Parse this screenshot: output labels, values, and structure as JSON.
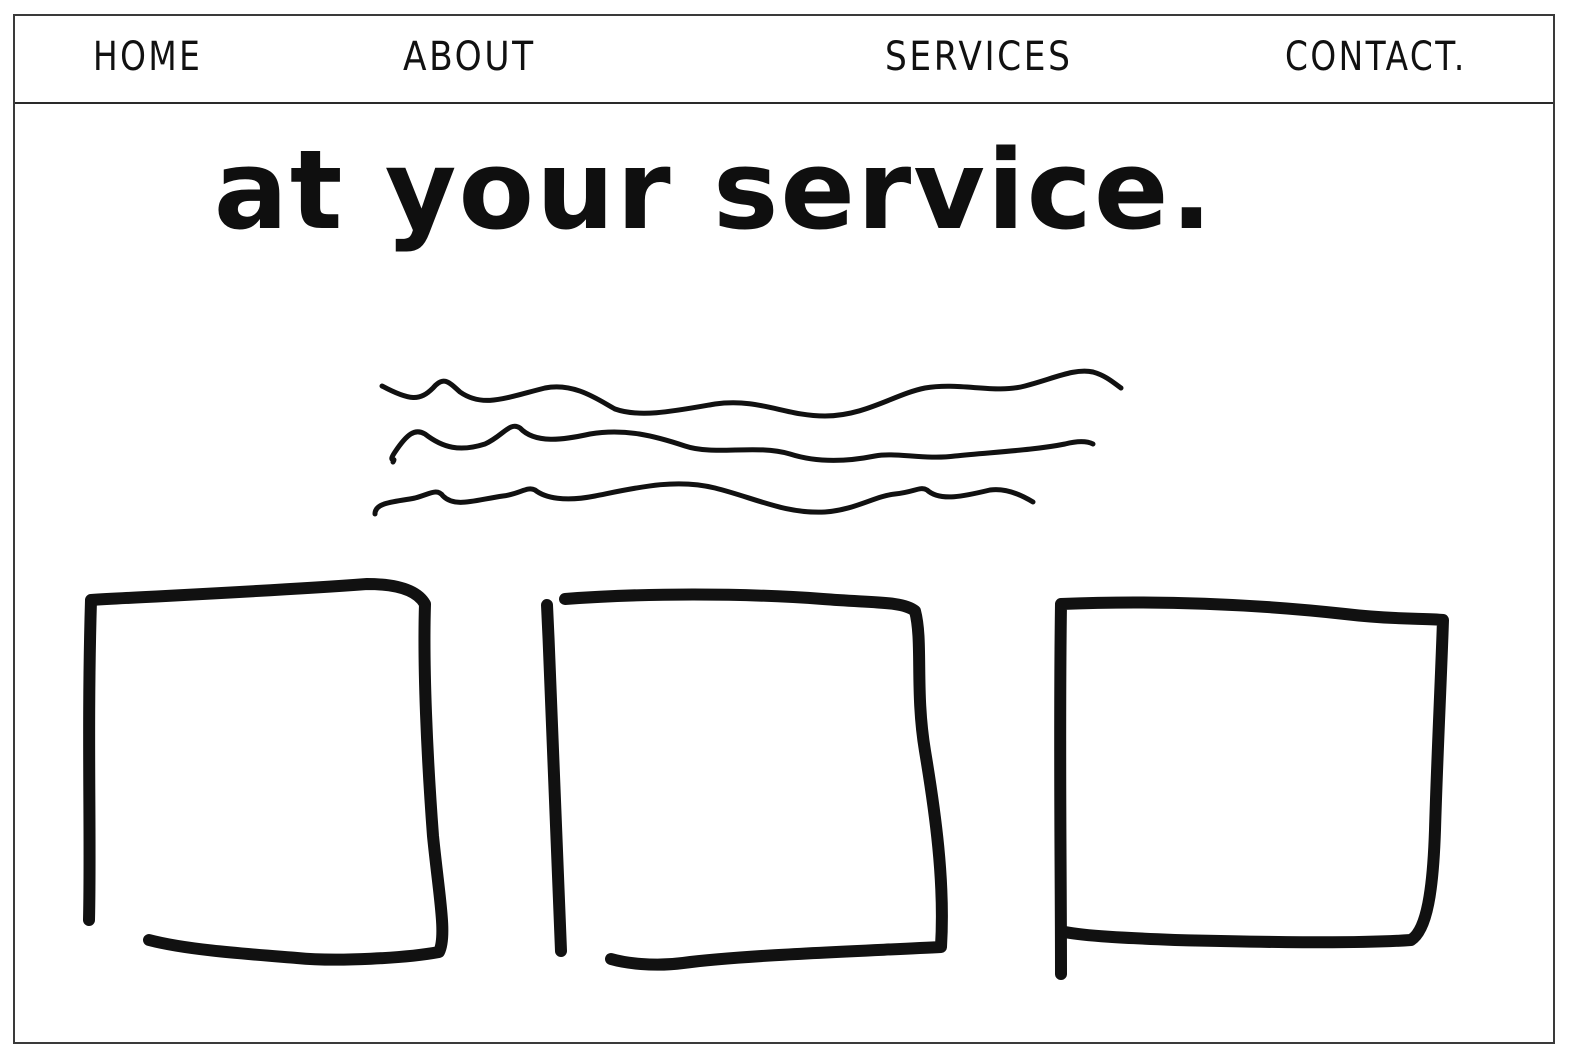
{
  "nav": {
    "items": [
      {
        "label": "HOME"
      },
      {
        "label": "ABOUT"
      },
      {
        "label": "SERVICES"
      },
      {
        "label": "CONTACT."
      }
    ]
  },
  "hero": {
    "title": "at your service."
  },
  "body_text": {
    "icon": "scribbled-text-placeholder",
    "line_count": 3
  },
  "cards": {
    "count": 3,
    "icon": "empty-card-placeholder"
  },
  "colors": {
    "stroke": "#111111",
    "frame": "#3a3a3a",
    "background": "#ffffff"
  }
}
